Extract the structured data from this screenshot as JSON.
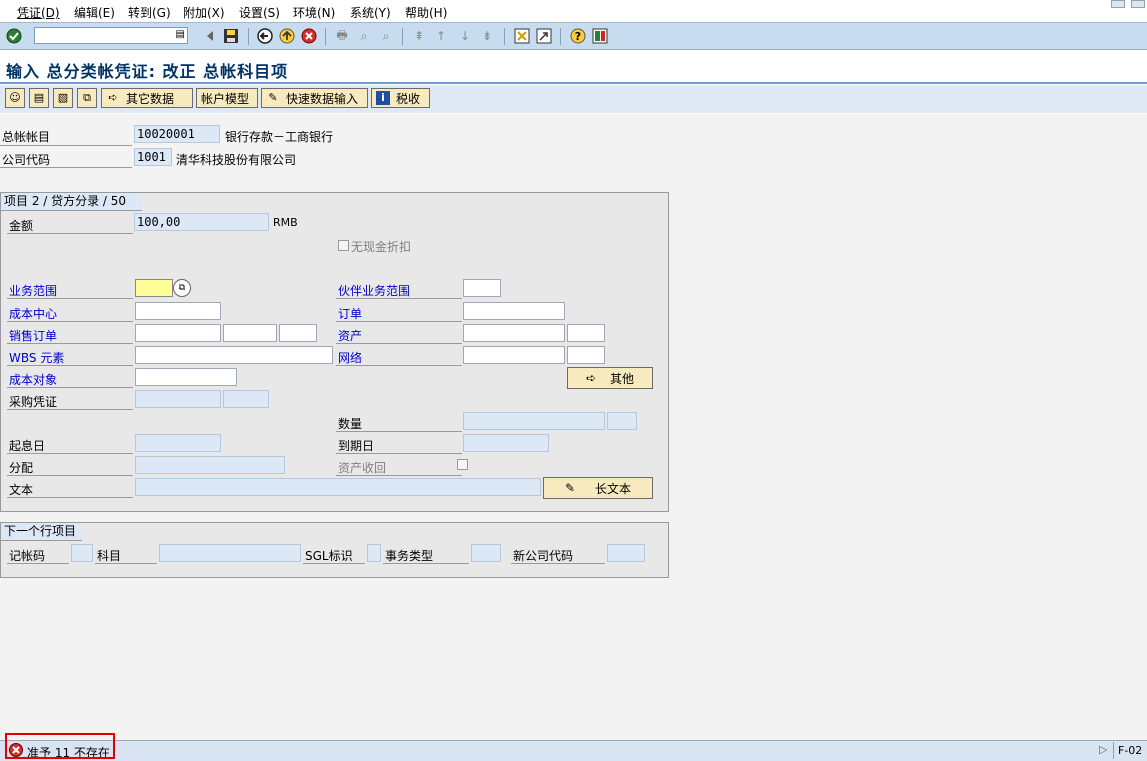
{
  "menu": [
    {
      "label": "凭证(D)"
    },
    {
      "label": "编辑(E)"
    },
    {
      "label": "转到(G)"
    },
    {
      "label": "附加(X)"
    },
    {
      "label": "设置(S)"
    },
    {
      "label": "环境(N)"
    },
    {
      "label": "系统(Y)"
    },
    {
      "label": "帮助(H)"
    }
  ],
  "toolbar": {
    "command_value": "",
    "icons": [
      "enter-icon",
      "back-icon",
      "exit-icon",
      "cancel-icon",
      "save-icon",
      "print-icon",
      "find-icon",
      "find-next-icon",
      "first-page-icon",
      "prev-page-icon",
      "next-page-icon",
      "last-page-icon",
      "new-session-icon",
      "shortcut-icon",
      "help-icon",
      "layout-icon"
    ]
  },
  "title": "输入 总分类帐凭证: 改正 总帐科目项",
  "app_toolbar": {
    "other_data": "其它数据",
    "account_model": "帐户模型",
    "fast_entry": "快速数据输入",
    "tax": "税收"
  },
  "header": {
    "gl_account_label": "总帐帐目",
    "gl_account_value": "10020001",
    "gl_account_desc": "银行存款－工商银行",
    "company_code_label": "公司代码",
    "company_code_value": "1001",
    "company_code_desc": "清华科技股份有限公司"
  },
  "item_group": {
    "title": "项目 2 / 贷方分录 / 50",
    "amount_label": "金额",
    "amount_value": "100,00",
    "currency": "RMB",
    "no_discount_label": "无现金折扣",
    "business_area_label": "业务范围",
    "business_area_value": "",
    "partner_ba_label": "伙伴业务范围",
    "cost_center_label": "成本中心",
    "order_label": "订单",
    "sales_order_label": "销售订单",
    "asset_label": "资产",
    "wbs_label": "WBS 元素",
    "network_label": "网络",
    "cost_object_label": "成本对象",
    "other_button": "其他",
    "purchasing_doc_label": "采购凭证",
    "quantity_label": "数量",
    "value_date_label": "起息日",
    "due_date_label": "到期日",
    "assignment_label": "分配",
    "asset_retirement_label": "资产收回",
    "text_label": "文本",
    "long_text_button": "长文本"
  },
  "next_item": {
    "title": "下一个行项目",
    "posting_key_label": "记帐码",
    "account_label": "科目",
    "sgl_label": "SGL标识",
    "trans_type_label": "事务类型",
    "new_company_label": "新公司代码"
  },
  "status": {
    "message": "准予 11 不存在",
    "system": "F-02"
  },
  "colors": {
    "error": "#e00000",
    "title": "#003366",
    "link": "#0000cc"
  }
}
